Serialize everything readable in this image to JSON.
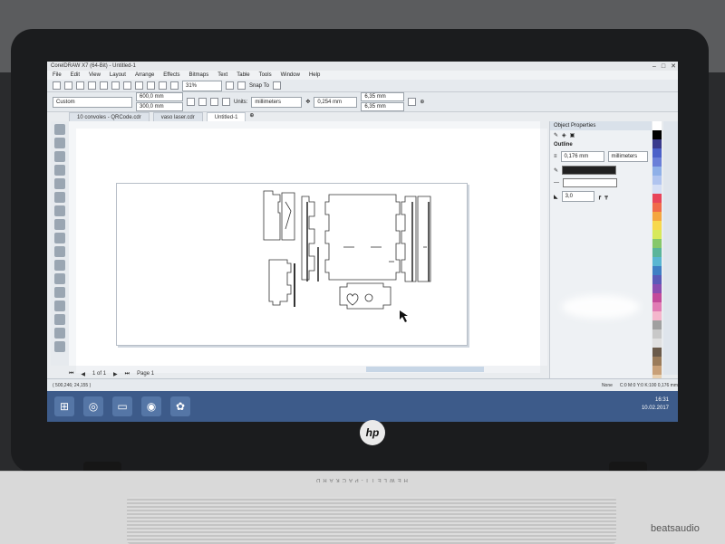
{
  "app": {
    "title": "CorelDRAW X7 (64-Bit) - Untitled-1",
    "menus": [
      "File",
      "Edit",
      "View",
      "Layout",
      "Arrange",
      "Effects",
      "Bitmaps",
      "Text",
      "Table",
      "Tools",
      "Window",
      "Help"
    ],
    "zoom": "31%",
    "snap_to": "Snap To",
    "preset": "Custom",
    "width": "600,0 mm",
    "height": "300,0 mm",
    "units_label": "Units:",
    "units": "millimeters",
    "nudge": "0,254 mm",
    "dup_x": "6,35 mm",
    "dup_y": "6,35 mm"
  },
  "doc_tabs": [
    "10 convoles - QRCode.cdr",
    "vaso laser.cdr",
    "Untitled-1"
  ],
  "page_nav": {
    "counter": "1 of 1",
    "page_label": "Page 1"
  },
  "docker": {
    "title": "Object Properties",
    "section": "Outline",
    "width": "0,176 mm",
    "units": "millimeters",
    "miter": "3,0"
  },
  "status": {
    "coords": "( 500,246; 24,155 )",
    "fill": "None",
    "outline": "C:0 M:0 Y:0 K:100 0,176 mm"
  },
  "taskbar": {
    "time": "16:31",
    "date": "10.02.2017"
  },
  "hardware": {
    "logo": "hp",
    "brand": "HEWLETT-PACKARD",
    "speaker": "beatsaudio"
  },
  "palette": [
    "#ffffff",
    "#000000",
    "#3a3a8c",
    "#4b60c8",
    "#6a7fd8",
    "#8fb0e8",
    "#b0c4ef",
    "#d5dff5",
    "#e8445a",
    "#f06a4a",
    "#f4a640",
    "#f7d84c",
    "#d7e95a",
    "#86c86a",
    "#5ab59a",
    "#59b6d2",
    "#3f7fc4",
    "#5a5ab8",
    "#8a4db0",
    "#c34a9a",
    "#e07bb4",
    "#f4b6cc",
    "#a0a0a0",
    "#c8c8c8",
    "#e0e0e0",
    "#6a5a4a",
    "#9a7b5a",
    "#c8a078",
    "#e8d0b0",
    "#505050"
  ]
}
